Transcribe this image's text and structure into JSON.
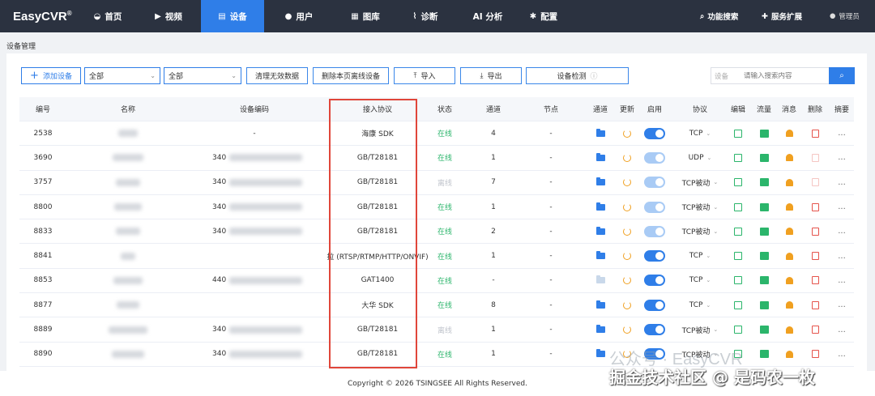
{
  "app": {
    "logo": "EasyCVR",
    "logo_mark": "®"
  },
  "nav": {
    "items": [
      {
        "label": "首页",
        "icon": "dashboard-icon"
      },
      {
        "label": "视频",
        "icon": "play-icon"
      },
      {
        "label": "设备",
        "icon": "device-icon",
        "active": true
      },
      {
        "label": "用户",
        "icon": "user-icon"
      },
      {
        "label": "图库",
        "icon": "gallery-icon"
      },
      {
        "label": "诊断",
        "icon": "pulse-icon"
      },
      {
        "label": "AI 分析",
        "icon": ""
      },
      {
        "label": "配置",
        "icon": "gear-icon"
      }
    ],
    "search_feature": "功能搜索",
    "service_ext": "服务扩展",
    "user": "管理员"
  },
  "breadcrumb": "设备管理",
  "toolbar": {
    "add_device": "添加设备",
    "filter1": "全部",
    "filter2": "全部",
    "clean": "清理无效数据",
    "delete_offline": "删除本页离线设备",
    "import": "导入",
    "export": "导出",
    "detect": "设备检测",
    "search_label": "设备",
    "search_placeholder": "请输入搜索内容"
  },
  "table": {
    "headers": {
      "id": "编号",
      "name": "名称",
      "code": "设备编码",
      "protocol": "接入协议",
      "status": "状态",
      "channels": "通道",
      "node": "节点",
      "channel": "通道",
      "update": "更新",
      "enable": "启用",
      "transport": "协议",
      "edit": "编辑",
      "flow": "流量",
      "message": "消息",
      "delete": "删除",
      "summary": "摘要"
    },
    "rows": [
      {
        "id": "2538",
        "code": "-",
        "protocol": "海康 SDK",
        "status": "在线",
        "channels": "4",
        "node": "-",
        "transport": "TCP"
      },
      {
        "id": "3690",
        "code": "340",
        "protocol": "GB/T28181",
        "status": "在线",
        "channels": "1",
        "node": "-",
        "transport": "UDP"
      },
      {
        "id": "3757",
        "code": "340",
        "protocol": "GB/T28181",
        "status": "离线",
        "channels": "7",
        "node": "-",
        "transport": "TCP被动"
      },
      {
        "id": "8800",
        "code": "340",
        "protocol": "GB/T28181",
        "status": "在线",
        "channels": "1",
        "node": "-",
        "transport": "TCP被动"
      },
      {
        "id": "8833",
        "code": "340",
        "protocol": "GB/T28181",
        "status": "在线",
        "channels": "2",
        "node": "-",
        "transport": "TCP被动"
      },
      {
        "id": "8841",
        "code": "",
        "protocol": "拉 (RTSP/RTMP/HTTP/ONVIF)",
        "status": "在线",
        "channels": "1",
        "node": "-",
        "transport": "TCP"
      },
      {
        "id": "8853",
        "code": "440",
        "protocol": "GAT1400",
        "status": "在线",
        "channels": "-",
        "node": "-",
        "transport": "TCP"
      },
      {
        "id": "8877",
        "code": "",
        "protocol": "大华 SDK",
        "status": "在线",
        "channels": "8",
        "node": "-",
        "transport": "TCP"
      },
      {
        "id": "8889",
        "code": "340",
        "protocol": "GB/T28181",
        "status": "离线",
        "channels": "1",
        "node": "-",
        "transport": "TCP被动"
      },
      {
        "id": "8890",
        "code": "340",
        "protocol": "GB/T28181",
        "status": "在线",
        "channels": "1",
        "node": "-",
        "transport": "TCP被动"
      }
    ]
  },
  "footer": "Copyright © 2026 TSINGSEE All Rights Reserved.",
  "watermark": {
    "line1": "公众号 · EasyCVR",
    "line2": "掘金技术社区 @ 是码农一枚"
  },
  "colors": {
    "nav_bg": "#2b3240",
    "accent": "#2f7ee8",
    "online": "#2bb56b",
    "highlight_box": "#e0463a"
  }
}
